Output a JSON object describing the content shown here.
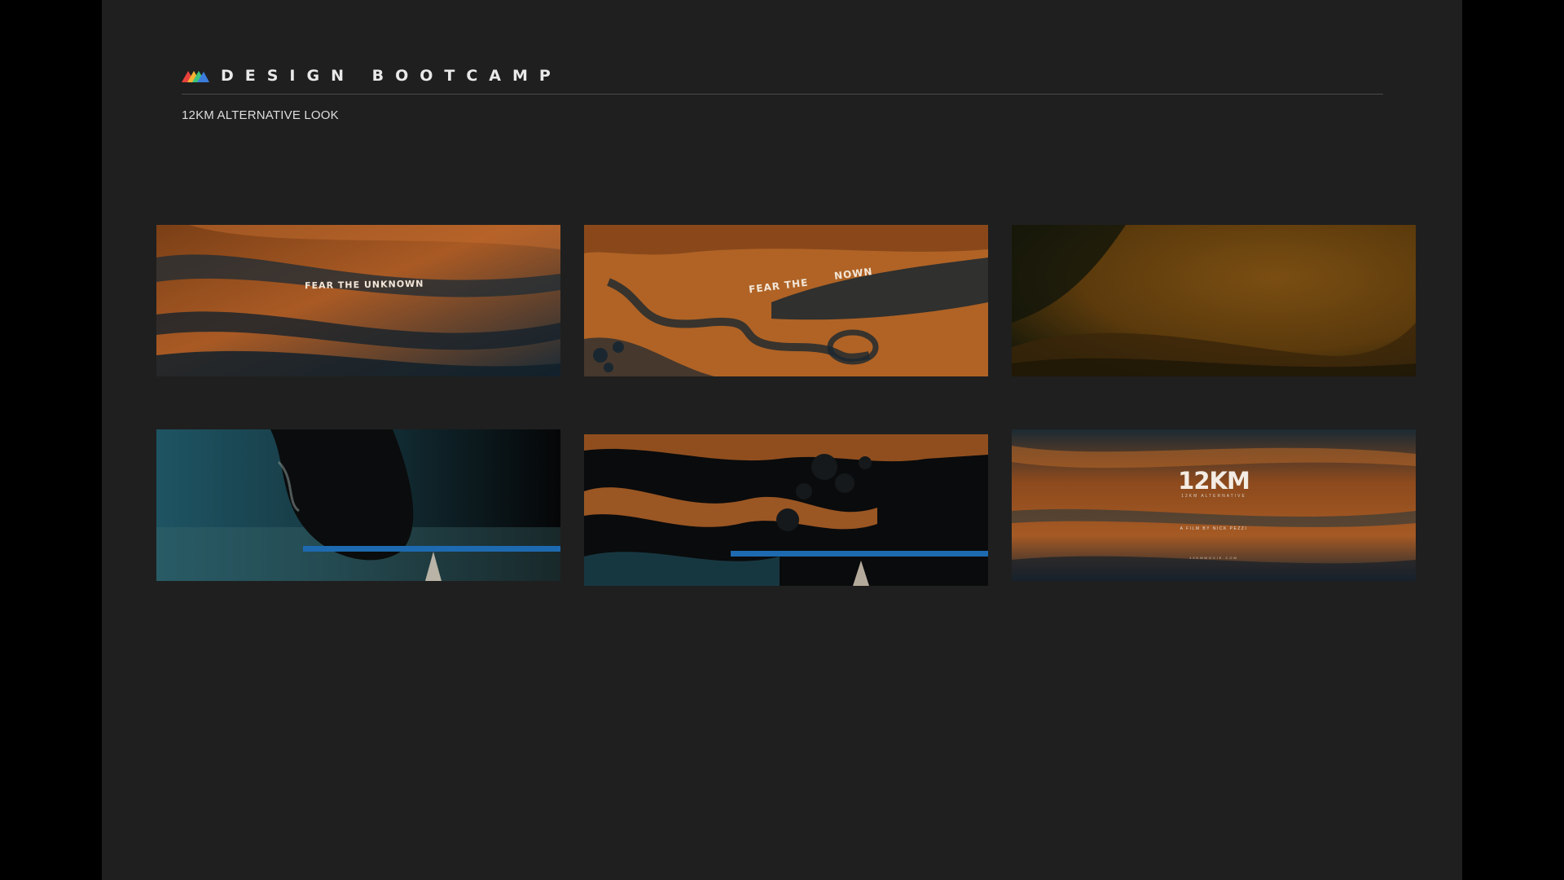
{
  "header": {
    "brand_name": "DESIGN BOOTCAMP",
    "logo_icon": "mountain-logo-icon",
    "subtitle": "12KM ALTERNATIVE LOOK"
  },
  "colors": {
    "page_background": "#000000",
    "slide_background": "#1f1f1f",
    "accent_orange": "#b4652a",
    "accent_teal": "#1d5a6a"
  },
  "thumbnails": [
    {
      "overlay_text": "FEAR THE UNKNOWN"
    },
    {
      "overlay_text_left": "FEAR THE",
      "overlay_text_right": "NOWN"
    },
    {},
    {},
    {},
    {
      "title_logo": "12KM",
      "title_subtitle": "12KM ALTERNATIVE",
      "credit": "A FILM BY NICK PEZZI",
      "website": "12KMMOVIE.COM"
    }
  ]
}
